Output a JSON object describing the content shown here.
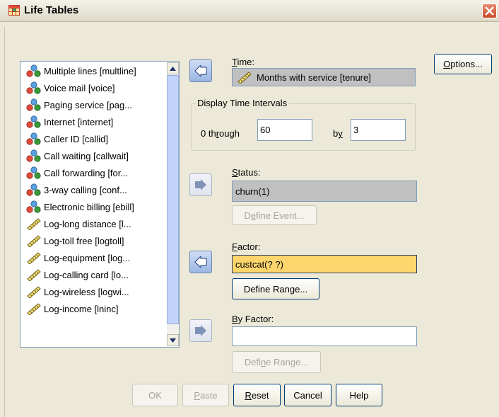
{
  "window": {
    "title": "Life Tables",
    "close_label": "✕"
  },
  "variables": [
    {
      "label": "Multiple lines [multline]",
      "icon": "nominal-icon"
    },
    {
      "label": "Voice mail [voice]",
      "icon": "nominal-icon"
    },
    {
      "label": "Paging service [pag...",
      "icon": "nominal-icon"
    },
    {
      "label": "Internet [internet]",
      "icon": "nominal-icon"
    },
    {
      "label": "Caller ID [callid]",
      "icon": "nominal-icon"
    },
    {
      "label": "Call waiting [callwait]",
      "icon": "nominal-icon"
    },
    {
      "label": "Call forwarding [for...",
      "icon": "nominal-icon"
    },
    {
      "label": "3-way calling [conf...",
      "icon": "nominal-icon"
    },
    {
      "label": "Electronic billing [ebill]",
      "icon": "nominal-icon"
    },
    {
      "label": "Log-long distance [l...",
      "icon": "scale-icon"
    },
    {
      "label": "Log-toll free [logtoll]",
      "icon": "scale-icon"
    },
    {
      "label": "Log-equipment [log...",
      "icon": "scale-icon"
    },
    {
      "label": "Log-calling card [lo...",
      "icon": "scale-icon"
    },
    {
      "label": "Log-wireless [logwi...",
      "icon": "scale-icon"
    },
    {
      "label": "Log-income [lninc]",
      "icon": "scale-icon"
    }
  ],
  "time": {
    "label": "Time:",
    "value": "Months with service [tenure]"
  },
  "intervals": {
    "legend": "Display Time Intervals",
    "through_pre": "0 th",
    "through_acc": "r",
    "through_post": "ough",
    "through_value": "60",
    "by_pre": "b",
    "by_acc": "y",
    "by_value": "3"
  },
  "status": {
    "label": "Status:",
    "value": "churn(1)",
    "define_event_pre": "D",
    "define_event_acc": "e",
    "define_event_post": "fine Event..."
  },
  "factor": {
    "label": "Factor:",
    "value": "custcat(? ?)",
    "define_range_pre": "Define Ran",
    "define_range_acc": "g",
    "define_range_post": "e..."
  },
  "by_factor": {
    "label": "By Factor:",
    "value": "",
    "define_range_pre": "Defi",
    "define_range_acc": "n",
    "define_range_post": "e Range..."
  },
  "buttons": {
    "options_acc": "O",
    "options_post": "ptions...",
    "ok": "OK",
    "paste_pre": "",
    "paste_acc": "P",
    "paste_post": "aste",
    "reset_acc": "R",
    "reset_post": "eset",
    "cancel": "Cancel",
    "help": "Help"
  },
  "colors": {
    "selected_field": "#ffd66e",
    "disabled_field": "#c0c0c0",
    "arrow_active": "#9bb6e4"
  }
}
